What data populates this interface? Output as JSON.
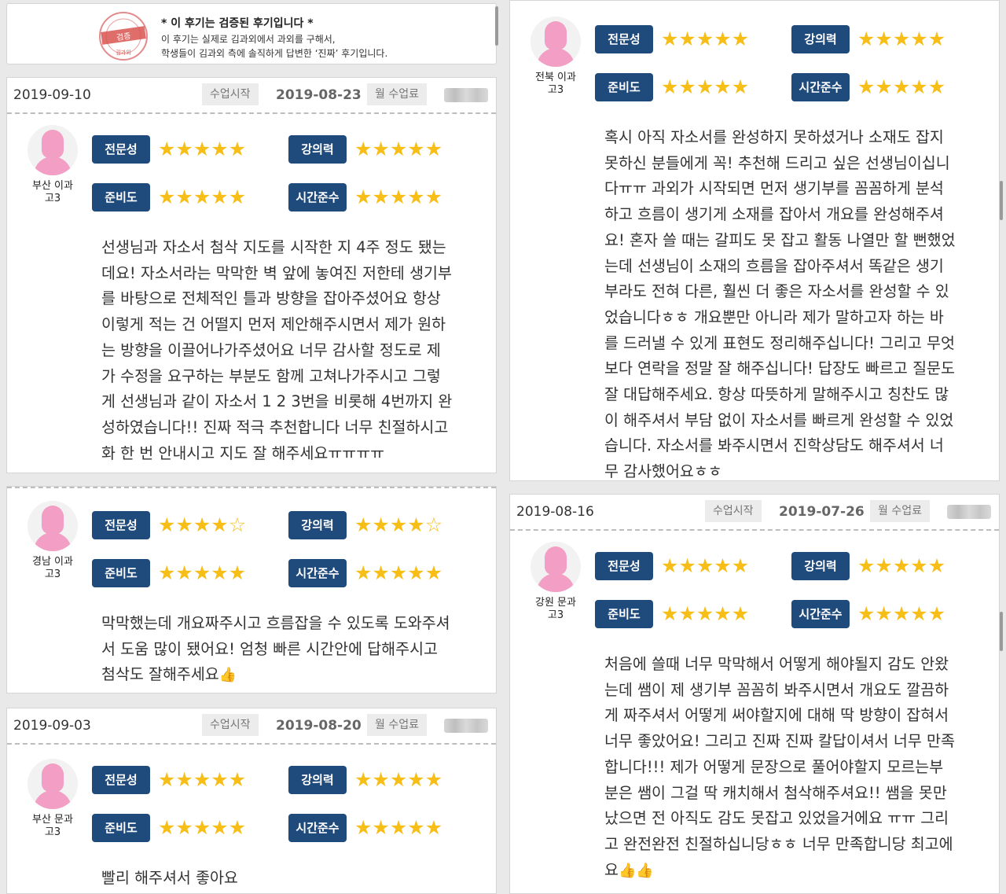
{
  "verify": {
    "stamp_text": "검증",
    "stamp_sub": "김과외",
    "title": "* 이 후기는 검증된 후기입니다 *",
    "line1": "이 후기는 실제로 김과외에서 과외를 구해서,",
    "line2": "학생들이 김과외 측에 솔직하게 답변한 ‘진짜’ 후기입니다."
  },
  "labels": {
    "start": "수업시작",
    "fee": "월 수업료",
    "expertise": "전문성",
    "teaching": "강의력",
    "preparation": "준비도",
    "punctuality": "시간준수"
  },
  "colors": {
    "badge": "#1f4a7c",
    "star": "#f6be16",
    "avatar": "#f29ec5"
  },
  "icons": {
    "star_full": "★",
    "star_empty": "☆",
    "thumb": "👍"
  },
  "reviews": [
    {
      "date": "2019-09-10",
      "start_date": "2019-08-23",
      "loc": "부산 이과",
      "grade": "고3",
      "ratings": {
        "expertise": 5,
        "teaching": 5,
        "preparation": 5,
        "punctuality": 5
      },
      "text": "선생님과 자소서 첨삭 지도를 시작한 지 4주 정도 됐는\n데요! 자소서라는 막막한 벽 앞에 놓여진 저한테 생기부\n를 바탕으로 전체적인 틀과 방향을 잡아주셨어요 항상\n이렇게 적는 건 어떨지 먼저 제안해주시면서 제가 원하\n는 방향을 이끌어나가주셨어요 너무 감사할 정도로 제\n가 수정을 요구하는 부분도 함께 고쳐나가주시고 그렇\n게 선생님과 같이 자소서 1 2 3번을 비롯해 4번까지 완\n성하였습니다!! 진짜 적극 추천합니다 너무 친절하시고\n화 한 번 안내시고 지도 잘 해주세요ㅠㅠㅠㅠ"
    },
    {
      "loc": "경남 이과",
      "grade": "고3",
      "ratings": {
        "expertise": 4,
        "teaching": 4,
        "preparation": 5,
        "punctuality": 5
      },
      "text": "막막했는데 개요짜주시고 흐름잡을 수 있도록 도와주셔\n서 도움 많이 됐어요! 엄청 빠른 시간안에 답해주시고\n첨삭도 잘해주세요"
    },
    {
      "date": "2019-09-03",
      "start_date": "2019-08-20",
      "loc": "부산 문과",
      "grade": "고3",
      "ratings": {
        "expertise": 5,
        "teaching": 5,
        "preparation": 5,
        "punctuality": 5
      },
      "text": "빨리 해주셔서 좋아요"
    },
    {
      "loc": "전북 이과",
      "grade": "고3",
      "ratings": {
        "expertise": 5,
        "teaching": 5,
        "preparation": 5,
        "punctuality": 5
      },
      "text": "혹시 아직 자소서를 완성하지 못하셨거나 소재도 잡지\n못하신 분들에게 꼭! 추천해 드리고 싶은 선생님이십니\n다ㅠㅠ 과외가 시작되면 먼저 생기부를 꼼꼼하게 분석\n하고 흐름이 생기게 소재를 잡아서 개요를 완성해주셔\n요! 혼자 쓸 때는 갈피도 못 잡고 활동 나열만 할 뻔했었\n는데 선생님이 소재의 흐름을 잡아주셔서 똑같은 생기\n부라도 전혀 다른, 훨씬 더 좋은 자소서를 완성할 수 있\n었습니다ㅎㅎ 개요뿐만 아니라 제가 말하고자 하는 바\n를 드러낼 수 있게 표현도 정리해주십니다! 그리고 무엇\n보다 연락을 정말 잘 해주십니다! 답장도 빠르고 질문도\n잘 대답해주세요. 항상 따뜻하게 말해주시고 칭찬도 많\n이 해주셔서 부담 없이 자소서를 빠르게 완성할 수 있었\n습니다. 자소서를 봐주시면서 진학상담도 해주셔서 너\n무 감사했어요ㅎㅎ"
    },
    {
      "date": "2019-08-16",
      "start_date": "2019-07-26",
      "loc": "강원 문과",
      "grade": "고3",
      "ratings": {
        "expertise": 5,
        "teaching": 5,
        "preparation": 5,
        "punctuality": 5
      },
      "text": "처음에 쓸때 너무 막막해서 어떻게 해야될지 감도 안왔\n는데 쌤이 제 생기부 꼼꼼히 봐주시면서 개요도 깔끔하\n게 짜주셔서 어떻게 써야할지에 대해 딱 방향이 잡혀서\n너무 좋았어요! 그리고 진짜 진짜 칼답이셔서 너무 만족\n합니다!!! 제가 어떻게 문장으로 풀어야할지 모르는부\n분은 쌤이 그걸 딱 캐치해서 첨삭해주셔요!! 쌤을 못만\n났으면 전 아직도 감도 못잡고 있었을거에요 ㅠㅠ 그리\n고 완전완전 친절하십니당ㅎㅎ 너무 만족합니당 최고에\n요"
    }
  ]
}
